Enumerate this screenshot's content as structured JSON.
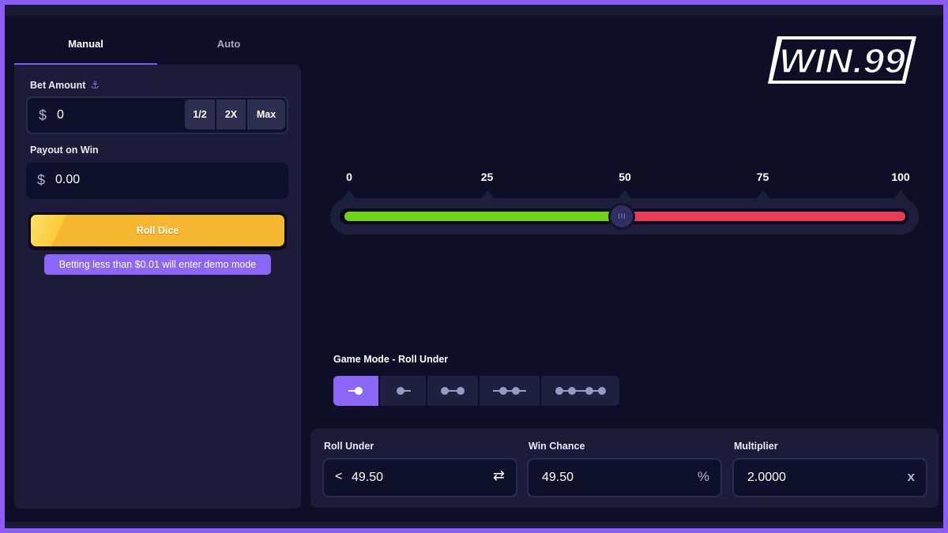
{
  "tabs": {
    "manual": "Manual",
    "auto": "Auto"
  },
  "bet": {
    "label": "Bet Amount",
    "currency": "$",
    "value": "0",
    "half": "1/2",
    "double": "2X",
    "max": "Max"
  },
  "payout": {
    "label": "Payout on Win",
    "currency": "$",
    "value": "0.00"
  },
  "roll_button": "Roll Dice",
  "demo_note": "Betting less than $0.01 will enter demo mode",
  "logo_text": "WIN.99",
  "slider": {
    "ticks": [
      "0",
      "25",
      "50",
      "75",
      "100"
    ],
    "value": 49.5,
    "min": 0,
    "max": 100,
    "handle_glyph": "III"
  },
  "game_mode": {
    "label": "Game Mode - Roll Under",
    "options": [
      "roll-under",
      "roll-over",
      "roll-between",
      "roll-outside",
      "roll-between-between"
    ],
    "selected": 0
  },
  "roll_under": {
    "label": "Roll Under",
    "prefix": "<",
    "value": "49.50",
    "icon": "⇄"
  },
  "win_chance": {
    "label": "Win Chance",
    "value": "49.50",
    "suffix": "%"
  },
  "multiplier": {
    "label": "Multiplier",
    "value": "2.0000",
    "suffix": "x"
  },
  "colors": {
    "accent": "#8b67f6",
    "win": "#6fd31c",
    "lose": "#e43d55",
    "roll_button": "#f5b630"
  }
}
